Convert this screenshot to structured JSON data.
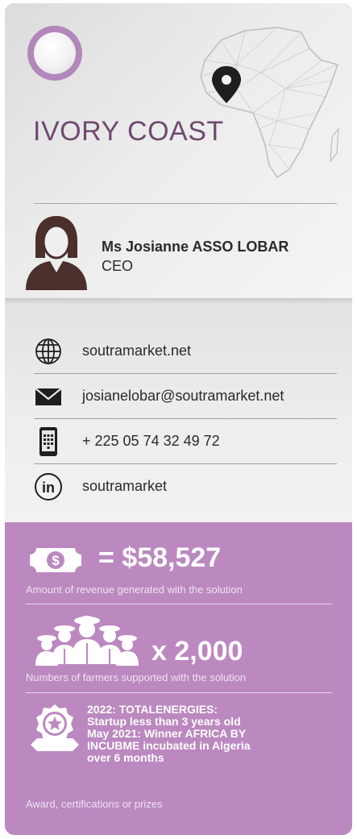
{
  "header": {
    "country": "IVORY COAST",
    "map_icon": "africa-map-with-pin"
  },
  "person": {
    "name": "Ms Josianne ASSO LOBAR",
    "role": "CEO",
    "avatar_icon": "woman-avatar-icon"
  },
  "contacts": [
    {
      "icon": "globe-icon",
      "text": "soutramarket.net"
    },
    {
      "icon": "envelope-icon",
      "text": "josianelobar@soutramarket.net"
    },
    {
      "icon": "phone-icon",
      "text": "+ 225 05 74 32 49 72"
    },
    {
      "icon": "linkedin-icon",
      "text": "soutramarket"
    }
  ],
  "stats": {
    "revenue": {
      "value": "= $58,527",
      "caption": "Amount of revenue generated with the solution",
      "icon": "money-icon"
    },
    "farmers": {
      "value": "x 2,000",
      "caption": "Numbers of farmers supported with the solution",
      "icon": "farmers-icon"
    }
  },
  "award": {
    "lines": [
      "2022: TOTALENERGIES:",
      "Startup less than 3 years old",
      "May 2021: Winner AFRICA BY",
      "INCUBME incubated in Algeria",
      "over 6 months"
    ],
    "caption": "Award, certifications or prizes",
    "icon": "award-badge-icon"
  },
  "colors": {
    "accent_purple": "#bb88c0",
    "title_purple": "#6e4a6f",
    "avatar_brown": "#4a2f2c"
  }
}
